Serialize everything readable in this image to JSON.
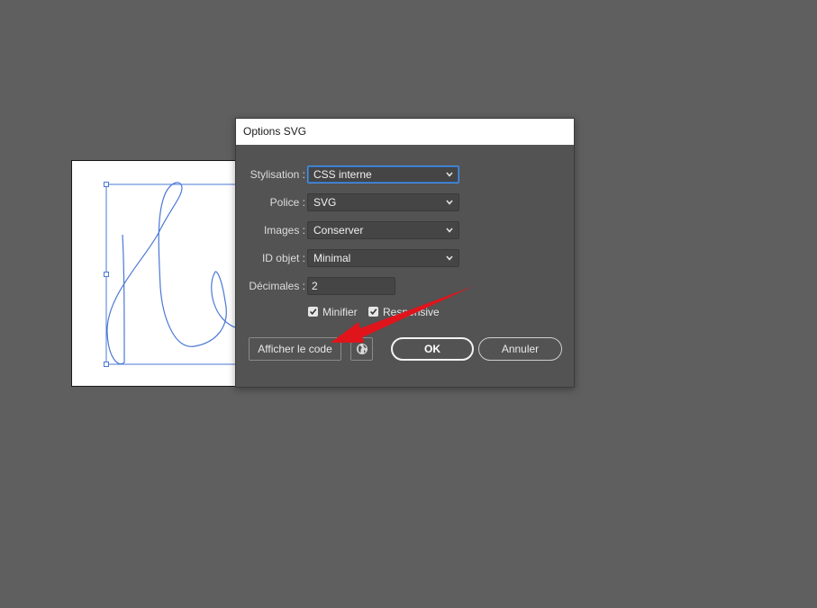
{
  "dialog": {
    "title": "Options SVG",
    "fields": {
      "styling": {
        "label": "Stylisation :",
        "value": "CSS interne"
      },
      "font": {
        "label": "Police :",
        "value": "SVG"
      },
      "images": {
        "label": "Images :",
        "value": "Conserver"
      },
      "object_id": {
        "label": "ID objet :",
        "value": "Minimal"
      },
      "decimals": {
        "label": "Décimales :",
        "value": "2"
      }
    },
    "checkboxes": {
      "minify": {
        "label": "Minifier",
        "checked": true
      },
      "responsive": {
        "label": "Responsive",
        "checked": true
      }
    },
    "buttons": {
      "show_code": "Afficher le code",
      "ok": "OK",
      "cancel": "Annuler"
    }
  },
  "icons": {
    "dropdown": "chevron-down-icon",
    "checkbox": "checkmark-icon",
    "globe": "globe-icon",
    "annotation": "red-arrow"
  },
  "colors": {
    "background": "#5f5f5f",
    "dialog": "#535353",
    "path": "#4a78d6",
    "arrow": "#e0141b"
  }
}
